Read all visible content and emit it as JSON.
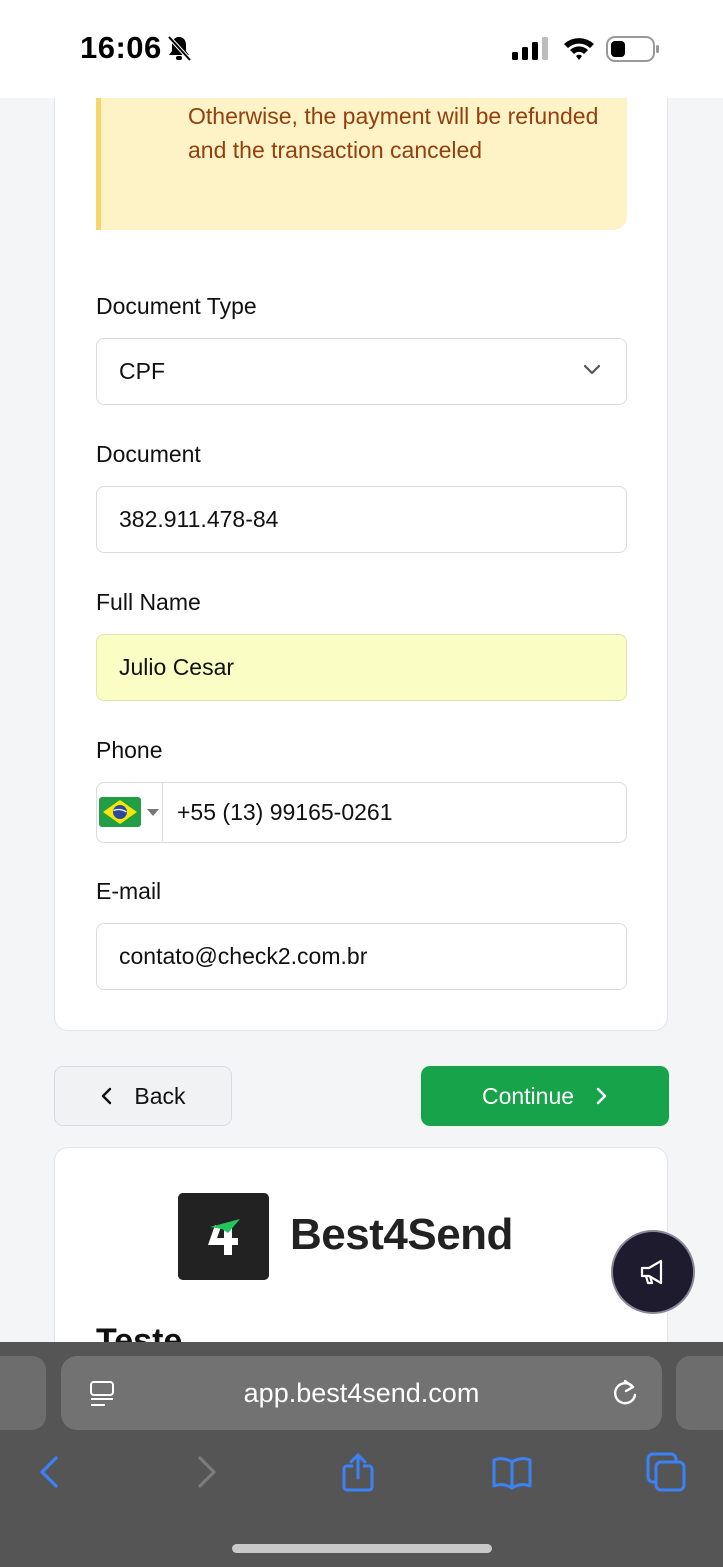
{
  "status_bar": {
    "time": "16:06"
  },
  "warning": {
    "text": "Otherwise, the payment will be refunded and the transaction canceled"
  },
  "form": {
    "document_type": {
      "label": "Document Type",
      "value": "CPF"
    },
    "document": {
      "label": "Document",
      "value": "382.911.478-84"
    },
    "full_name": {
      "label": "Full Name",
      "value": "Julio Cesar"
    },
    "phone": {
      "label": "Phone",
      "country": "brazil-flag-icon",
      "value": "+55 (13) 99165-0261"
    },
    "email": {
      "label": "E-mail",
      "value": "contato@check2.com.br"
    }
  },
  "actions": {
    "back_label": "Back",
    "continue_label": "Continue"
  },
  "brand": {
    "logo_text": "Best4Send",
    "section_title": "Teste"
  },
  "browser": {
    "url": "app.best4send.com"
  },
  "colors": {
    "primary_green": "#16a34a",
    "warning_bg": "#fef3c7",
    "warning_text": "#92400e",
    "autofill_bg": "#fafdc4"
  }
}
